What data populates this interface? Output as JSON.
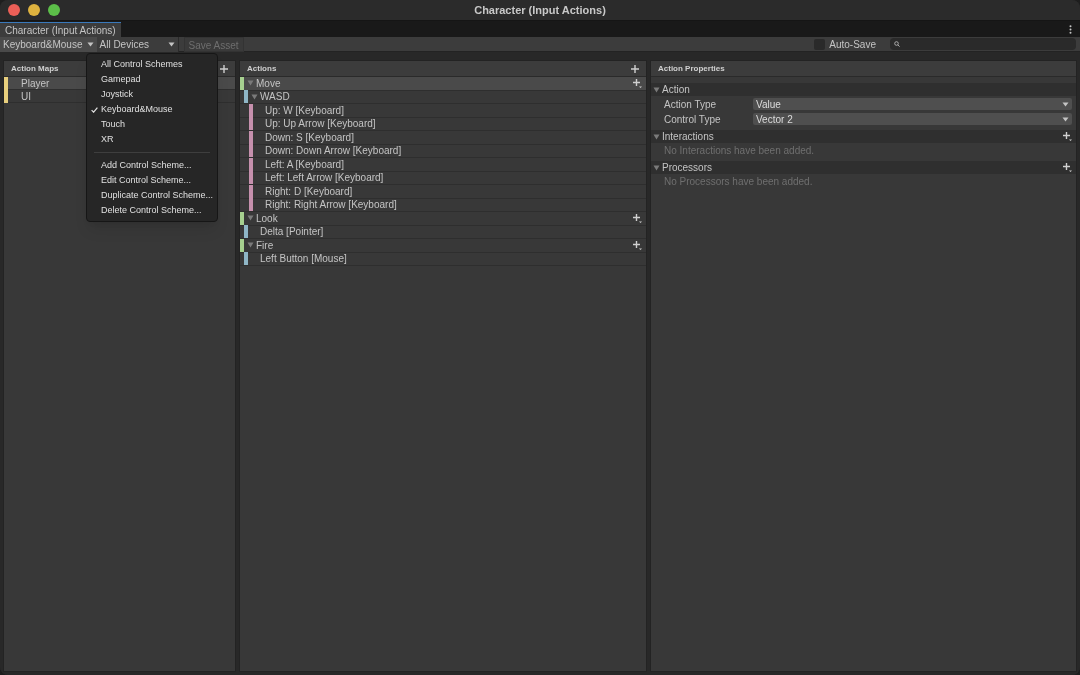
{
  "window": {
    "title": "Character (Input Actions)"
  },
  "tabs": [
    {
      "label": "Character (Input Actions)",
      "selected": true
    }
  ],
  "toolbar": {
    "control_scheme": "Keyboard&Mouse",
    "devices": "All Devices",
    "save_button": {
      "label": "Save Asset",
      "disabled": true
    },
    "auto_save": {
      "label": "Auto-Save",
      "checked": false
    }
  },
  "scheme_menu": {
    "items": [
      {
        "kind": "option",
        "label": "All Control Schemes",
        "checked": false
      },
      {
        "kind": "option",
        "label": "Gamepad",
        "checked": false
      },
      {
        "kind": "option",
        "label": "Joystick",
        "checked": false
      },
      {
        "kind": "option",
        "label": "Keyboard&Mouse",
        "checked": true
      },
      {
        "kind": "option",
        "label": "Touch",
        "checked": false
      },
      {
        "kind": "option",
        "label": "XR",
        "checked": false
      },
      {
        "kind": "separator"
      },
      {
        "kind": "option",
        "label": "Add Control Scheme...",
        "checked": false
      },
      {
        "kind": "option",
        "label": "Edit Control Scheme...",
        "checked": false
      },
      {
        "kind": "option",
        "label": "Duplicate Control Scheme...",
        "checked": false
      },
      {
        "kind": "option",
        "label": "Delete Control Scheme...",
        "checked": false
      }
    ]
  },
  "action_maps": {
    "title": "Action Maps",
    "items": [
      {
        "label": "Player",
        "selected": true,
        "color": "#e8cf7d"
      },
      {
        "label": "UI",
        "selected": false,
        "color": "#e8cf7d"
      }
    ]
  },
  "actions": {
    "title": "Actions",
    "items": [
      {
        "kind": "action",
        "label": "Move",
        "selected": true,
        "color": "#a6d08f",
        "children": [
          {
            "kind": "composite",
            "label": "WASD",
            "selected": false,
            "color": "#8fb6c6",
            "children": [
              {
                "kind": "part",
                "label": "Up: W [Keyboard]",
                "selected": false,
                "color": "#c690ad"
              },
              {
                "kind": "part",
                "label": "Up: Up Arrow [Keyboard]",
                "selected": false,
                "color": "#c690ad"
              },
              {
                "kind": "part",
                "label": "Down: S [Keyboard]",
                "selected": false,
                "color": "#c690ad"
              },
              {
                "kind": "part",
                "label": "Down: Down Arrow [Keyboard]",
                "selected": false,
                "color": "#c690ad"
              },
              {
                "kind": "part",
                "label": "Left: A [Keyboard]",
                "selected": false,
                "color": "#c690ad"
              },
              {
                "kind": "part",
                "label": "Left: Left Arrow [Keyboard]",
                "selected": false,
                "color": "#c690ad"
              },
              {
                "kind": "part",
                "label": "Right: D [Keyboard]",
                "selected": false,
                "color": "#c690ad"
              },
              {
                "kind": "part",
                "label": "Right: Right Arrow [Keyboard]",
                "selected": false,
                "color": "#c690ad"
              }
            ]
          }
        ]
      },
      {
        "kind": "action",
        "label": "Look",
        "selected": false,
        "color": "#a6d08f",
        "children": [
          {
            "kind": "binding",
            "label": "Delta [Pointer]",
            "selected": false,
            "color": "#8fb6c6"
          }
        ]
      },
      {
        "kind": "action",
        "label": "Fire",
        "selected": false,
        "color": "#a6d08f",
        "children": [
          {
            "kind": "binding",
            "label": "Left Button [Mouse]",
            "selected": false,
            "color": "#8fb6c6"
          }
        ]
      }
    ]
  },
  "properties": {
    "title": "Action Properties",
    "sections": [
      {
        "title": "Action",
        "fields": [
          {
            "label": "Action Type",
            "value": "Value"
          },
          {
            "label": "Control Type",
            "value": "Vector 2"
          }
        ]
      },
      {
        "title": "Interactions",
        "empty_text": "No Interactions have been added."
      },
      {
        "title": "Processors",
        "empty_text": "No Processors have been added."
      }
    ]
  }
}
